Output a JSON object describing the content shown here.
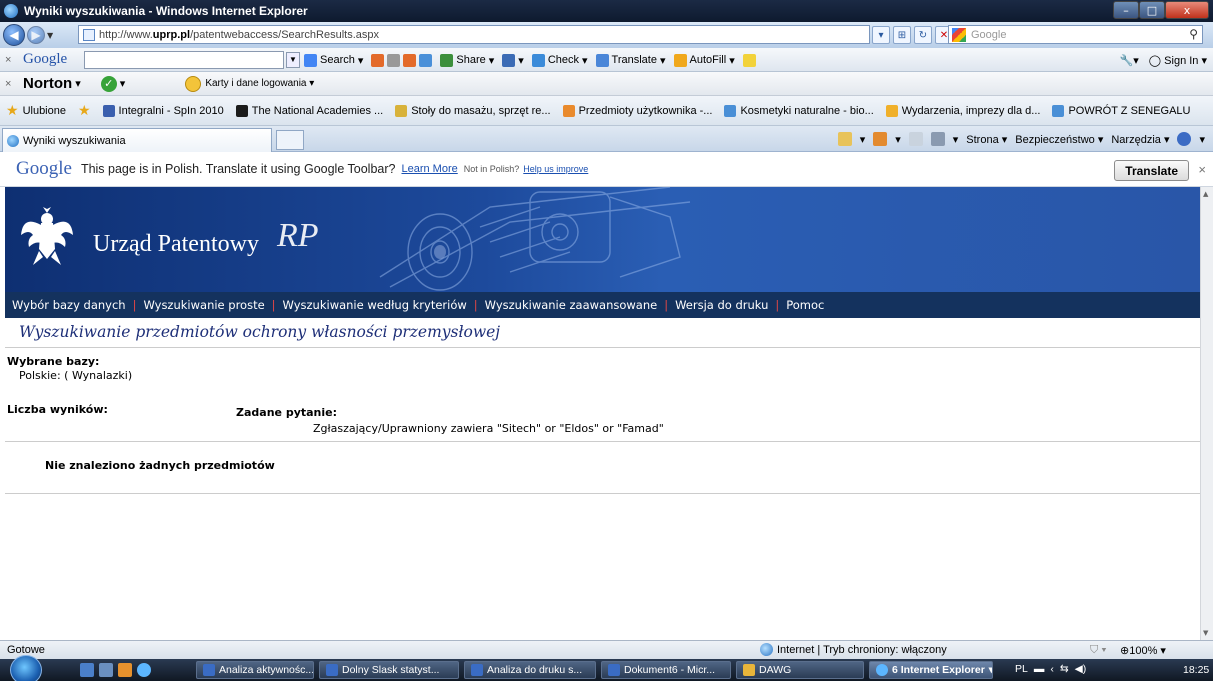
{
  "window": {
    "title": "Wyniki wyszukiwania - Windows Internet Explorer",
    "min": "–",
    "max": "□",
    "close": "x"
  },
  "address": {
    "url_prefix": "http://www.",
    "url_domain": "uprp.pl",
    "url_path": "/patentwebaccess/SearchResults.aspx",
    "search_placeholder": "Google"
  },
  "google_toolbar": {
    "logo": "Google",
    "items": [
      "Search",
      "Share",
      "Check",
      "Translate",
      "AutoFill"
    ],
    "signin": "Sign In"
  },
  "norton": {
    "logo": "Norton",
    "karty": "Karty i dane logowania"
  },
  "favorites": {
    "ulubione": "Ulubione",
    "links": [
      "Integralni - SpIn 2010",
      "The National Academies ...",
      "Stoły do masażu, sprzęt re...",
      "Przedmioty użytkownika -...",
      "Kosmetyki naturalne - bio...",
      "Wydarzenia, imprezy dla d...",
      "POWRÓT Z SENEGALU"
    ]
  },
  "tab": {
    "label": "Wyniki wyszukiwania",
    "commands": [
      "Strona",
      "Bezpieczeństwo",
      "Narzędzia"
    ]
  },
  "translate_bar": {
    "logo": "Google",
    "message": "This page is in Polish.  Translate it using Google Toolbar?",
    "learn_more": "Learn More",
    "not_polish": "Not in Polish?",
    "help": "Help us improve",
    "button": "Translate",
    "close": "×"
  },
  "page": {
    "brand": "Urząd Patentowy",
    "brand_rp": "RP",
    "menu": [
      "Wybór bazy danych",
      "Wyszukiwanie proste",
      "Wyszukiwanie według kryteriów",
      "Wyszukiwanie zaawansowane",
      "Wersja do druku",
      "Pomoc"
    ],
    "heading": "Wyszukiwanie przedmiotów ochrony własności przemysłowej",
    "selected_label": "Wybrane bazy:",
    "selected_value": "Polskie: ( Wynalazki)",
    "results_label": "Liczba wyników:",
    "query_label": "Zadane pytanie:",
    "query_value": "Zgłaszający/Uprawniony zawiera \"Sitech\" or \"Eldos\" or \"Famad\"",
    "no_results": "Nie znaleziono żadnych przedmiotów"
  },
  "status": {
    "left": "Gotowe",
    "zone": "Internet | Tryb chroniony: włączony",
    "zoom": "100%"
  },
  "taskbar": {
    "tasks": [
      "Analiza aktywnośc...",
      "Dolny Slask statyst...",
      "Analiza do druku s...",
      "Dokument6 - Micr...",
      "DAWG",
      "6 Internet Explorer"
    ],
    "lang": "PL",
    "time": "18:25"
  }
}
